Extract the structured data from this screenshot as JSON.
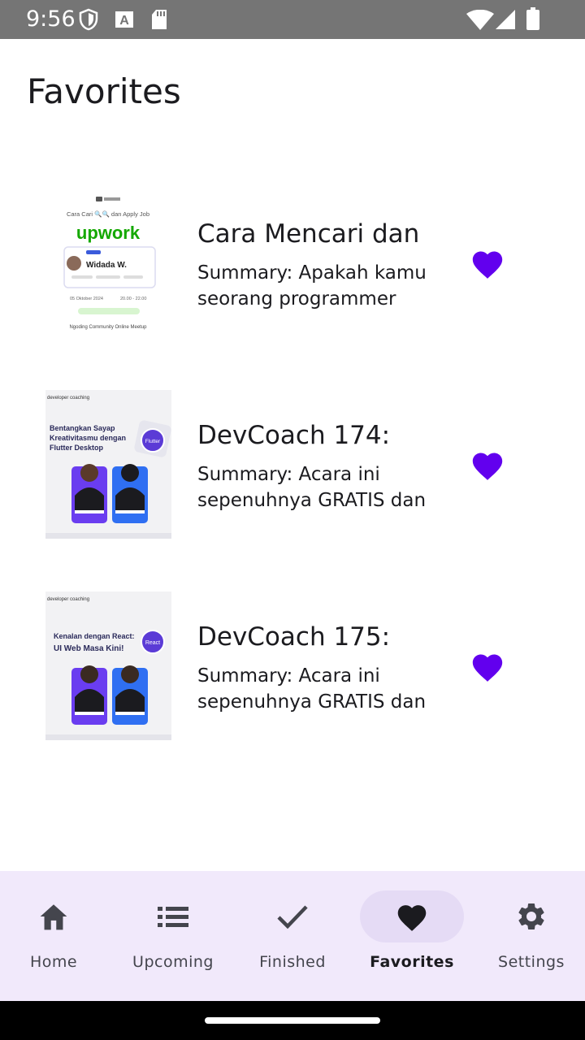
{
  "status_bar": {
    "time": "9:56",
    "icons": [
      "shield-icon",
      "font-icon",
      "sd-card-icon",
      "wifi-icon",
      "signal-icon",
      "battery-icon"
    ]
  },
  "page": {
    "title": "Favorites"
  },
  "events": [
    {
      "title": "Cara Mencari dan",
      "summary": "Summary: Apakah kamu seorang programmer",
      "favorite": true,
      "thumbnail": {
        "heading": "Cara Cari 🔍🔍 dan Apply Job",
        "brand": "upwork",
        "speaker": "Widada W.",
        "date": "05 Oktober 2024",
        "time": "20.00 - 22.00",
        "footer": "Ngoding Community Online Meetup"
      }
    },
    {
      "title": "DevCoach 174:",
      "summary": "Summary: Acara ini sepenuhnya GRATIS dan",
      "favorite": true,
      "thumbnail": {
        "brand": "developer coaching",
        "heading": "Bentangkan Sayap Kreativitasmu dengan Flutter Desktop",
        "badge": "Flutter"
      }
    },
    {
      "title": "DevCoach 175:",
      "summary": "Summary: Acara ini sepenuhnya GRATIS dan",
      "favorite": true,
      "thumbnail": {
        "brand": "developer coaching",
        "heading": "Kenalan dengan React: UI Web Masa Kini!",
        "badge": "React"
      }
    }
  ],
  "bottom_nav": {
    "items": [
      {
        "label": "Home",
        "icon": "home-icon",
        "active": false
      },
      {
        "label": "Upcoming",
        "icon": "list-icon",
        "active": false
      },
      {
        "label": "Finished",
        "icon": "check-icon",
        "active": false
      },
      {
        "label": "Favorites",
        "icon": "heart-icon",
        "active": true
      },
      {
        "label": "Settings",
        "icon": "gear-icon",
        "active": false
      }
    ]
  },
  "colors": {
    "accent": "#6200ee",
    "status_bar": "#757575",
    "nav_background": "#f1e9fb",
    "nav_active_pill": "#e5dbf5"
  }
}
